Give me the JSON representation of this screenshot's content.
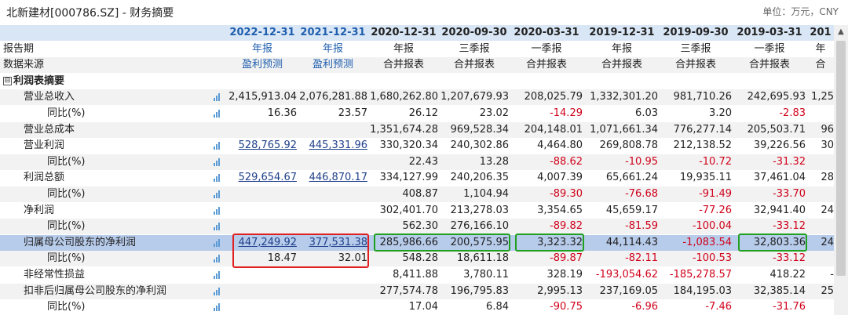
{
  "title": "北新建材[000786.SZ] - 财务摘要",
  "unit": "单位：万元，CNY",
  "header": [
    "2022-12-31",
    "2021-12-31",
    "2020-12-31",
    "2020-09-30",
    "2020-03-31",
    "2019-12-31",
    "2019-09-30",
    "2019-03-31",
    "201"
  ],
  "rows": [
    {
      "label": "报告期",
      "values": [
        "年报",
        "年报",
        "年报",
        "三季报",
        "一季报",
        "年报",
        "三季报",
        "一季报",
        "年"
      ]
    },
    {
      "label": "数据来源",
      "values": [
        "盈利预测",
        "盈利预测",
        "合并报表",
        "合并报表",
        "合并报表",
        "合并报表",
        "合并报表",
        "合并报表",
        "合"
      ]
    },
    {
      "label": "利润表摘要",
      "values": [
        "",
        "",
        "",
        "",
        "",
        "",
        "",
        "",
        ""
      ]
    },
    {
      "label": "营业总收入",
      "values": [
        "2,415,913.04",
        "2,076,281.88",
        "1,680,262.80",
        "1,207,679.93",
        "208,025.79",
        "1,332,301.20",
        "981,710.26",
        "242,695.93",
        "1,25"
      ]
    },
    {
      "label": "同比(%)",
      "values": [
        "16.36",
        "23.57",
        "26.12",
        "23.02",
        "-14.29",
        "6.03",
        "3.20",
        "-2.83",
        ""
      ]
    },
    {
      "label": "营业总成本",
      "values": [
        "",
        "",
        "1,351,674.28",
        "969,528.34",
        "204,148.01",
        "1,071,661.34",
        "776,277.14",
        "205,503.71",
        "96"
      ]
    },
    {
      "label": "营业利润",
      "values": [
        "528,765.92",
        "445,331.96",
        "330,320.34",
        "240,302.86",
        "4,464.80",
        "269,808.78",
        "212,138.52",
        "39,226.56",
        "30"
      ]
    },
    {
      "label": "同比(%)",
      "values": [
        "",
        "",
        "22.43",
        "13.28",
        "-88.62",
        "-10.95",
        "-10.72",
        "-31.32",
        ""
      ]
    },
    {
      "label": "利润总额",
      "values": [
        "529,654.67",
        "446,870.17",
        "334,127.99",
        "240,206.35",
        "4,007.39",
        "65,661.24",
        "19,935.11",
        "37,461.04",
        "28"
      ]
    },
    {
      "label": "同比(%)",
      "values": [
        "",
        "",
        "408.87",
        "1,104.94",
        "-89.30",
        "-76.68",
        "-91.49",
        "-33.70",
        ""
      ]
    },
    {
      "label": "净利润",
      "values": [
        "",
        "",
        "302,401.70",
        "213,278.03",
        "3,354.65",
        "45,659.17",
        "-77.26",
        "32,941.40",
        "24"
      ]
    },
    {
      "label": "同比(%)",
      "values": [
        "",
        "",
        "562.30",
        "276,166.10",
        "-89.82",
        "-81.59",
        "-100.04",
        "-33.12",
        ""
      ]
    },
    {
      "label": "归属母公司股东的净利润",
      "values": [
        "447,249.92",
        "377,531.38",
        "285,986.66",
        "200,575.95",
        "3,323.32",
        "44,114.43",
        "-1,083.54",
        "32,803.36",
        "24"
      ]
    },
    {
      "label": "同比(%)",
      "values": [
        "18.47",
        "32.01",
        "548.28",
        "18,611.18",
        "-89.87",
        "-82.11",
        "-100.53",
        "-33.12",
        ""
      ]
    },
    {
      "label": "非经常性损益",
      "values": [
        "",
        "",
        "8,411.88",
        "3,780.11",
        "328.19",
        "-193,054.62",
        "-185,278.57",
        "418.22",
        "-"
      ]
    },
    {
      "label": "扣非后归属母公司股东的净利润",
      "values": [
        "",
        "",
        "277,574.78",
        "196,795.83",
        "2,995.13",
        "237,169.05",
        "184,195.03",
        "32,385.14",
        "25"
      ]
    },
    {
      "label": "同比(%)",
      "values": [
        "",
        "",
        "17.04",
        "6.84",
        "-90.75",
        "-6.96",
        "-7.46",
        "-31.76",
        ""
      ]
    }
  ],
  "colors": {
    "red_box": "#e02020",
    "green_box": "#1fa01f",
    "header_bg": "#d9e6f5",
    "highlight_row": "#b7cbea"
  }
}
